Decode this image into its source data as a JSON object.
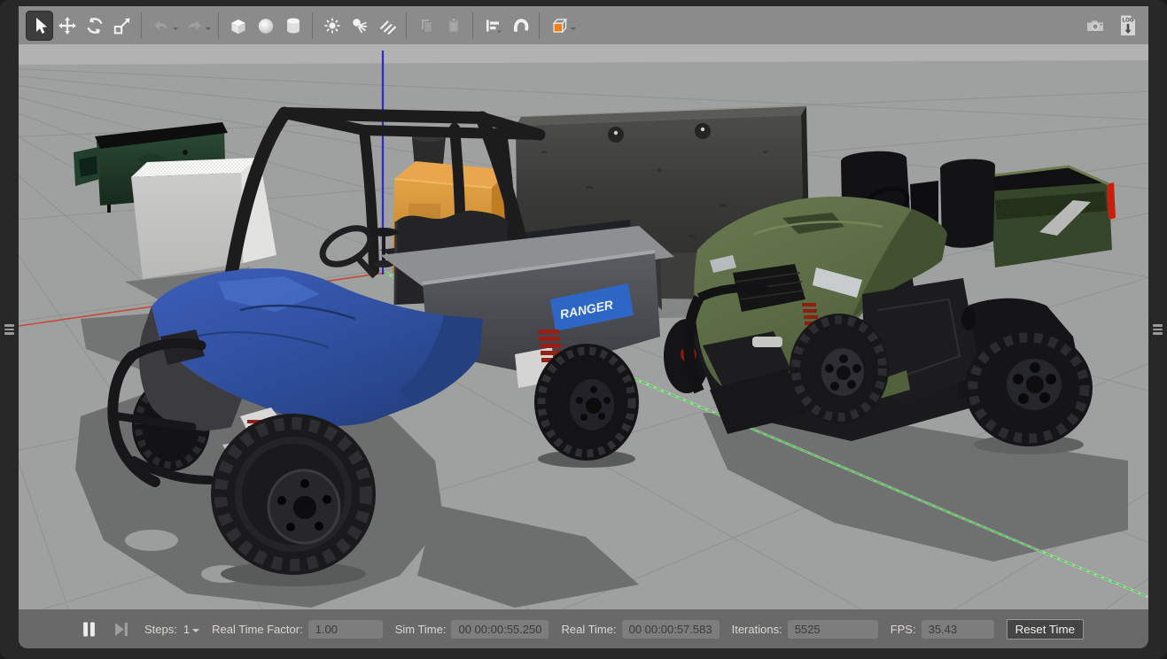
{
  "toolbar": {
    "icons": [
      "select-tool",
      "translate-tool",
      "rotate-tool",
      "scale-tool",
      "undo",
      "redo",
      "add-box",
      "add-sphere",
      "add-cylinder",
      "point-light",
      "spot-light",
      "directional-light",
      "copy",
      "paste",
      "align",
      "snap",
      "view-angle",
      "screenshot-camera",
      "data-logger"
    ],
    "log_label": "LOG"
  },
  "statusbar": {
    "steps_label": "Steps:",
    "steps_value": "1",
    "rtf_label": "Real Time Factor:",
    "rtf_value": "1.00",
    "sim_label": "Sim Time:",
    "sim_value": "00 00:00:55.250",
    "real_label": "Real Time:",
    "real_value": "00 00:00:57.583",
    "iter_label": "Iterations:",
    "iter_value": "5525",
    "fps_label": "FPS:",
    "fps_value": "35.43",
    "reset_label": "Reset Time"
  },
  "scene": {
    "decal_text": "RANGER",
    "objects": [
      "dumpster",
      "white-box",
      "orange-box",
      "concrete-barrier",
      "utv-blue",
      "utv-green"
    ],
    "colors": {
      "sky": "#b2b2b2",
      "ground": "#9fa0a0",
      "axis_x": "#c8483a",
      "axis_y": "#35d435",
      "axis_z": "#2b28cf",
      "blue_vehicle": "#2f4f9e",
      "green_vehicle": "#5a6a44",
      "orange_box": "#d8942f",
      "dumpster_green": "#27412e"
    }
  }
}
